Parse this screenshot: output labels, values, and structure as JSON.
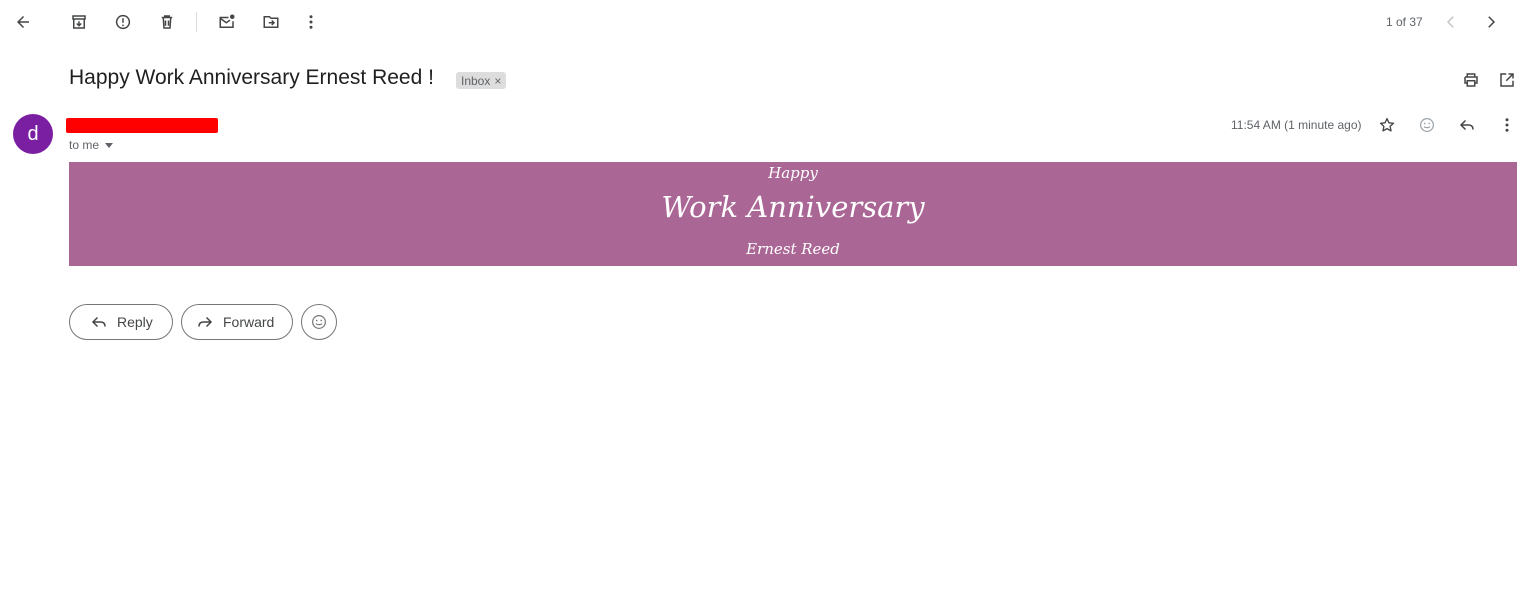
{
  "toolbar": {
    "back_icon": "arrow-left-icon",
    "archive_icon": "archive-icon",
    "spam_icon": "report-spam-icon",
    "delete_icon": "trash-icon",
    "mark_unread_icon": "mark-unread-icon",
    "move_icon": "move-to-folder-icon",
    "more_icon": "more-vert-icon"
  },
  "pager": {
    "text": "1 of 37",
    "prev_icon": "chevron-left-icon",
    "next_icon": "chevron-right-icon"
  },
  "email": {
    "subject": "Happy Work Anniversary Ernest Reed !",
    "label": "Inbox",
    "label_remove": "×",
    "avatar_letter": "d",
    "avatar_color": "#7b1fa2",
    "recipient": "to me",
    "timestamp": "11:54 AM (1 minute ago)",
    "redaction_color": "#ff0000"
  },
  "banner": {
    "line1": "Happy",
    "line2": "Work Anniversary",
    "line3": "Ernest Reed",
    "background": "#aa6796"
  },
  "actions": {
    "reply_label": "Reply",
    "forward_label": "Forward"
  }
}
